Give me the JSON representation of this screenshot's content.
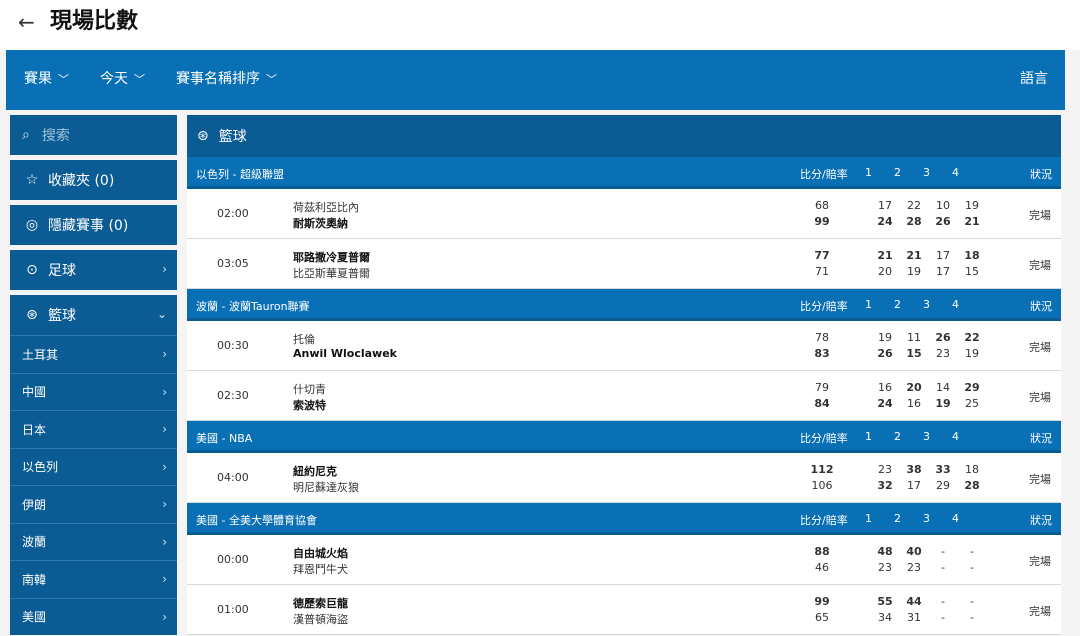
{
  "header": {
    "back_icon": "arrow-left-icon",
    "title": "現場比數"
  },
  "nav": {
    "results": "賽果",
    "today": "今天",
    "sort": "賽事名稱排序",
    "language": "語言"
  },
  "sidebar": {
    "search_placeholder": "搜索",
    "favorites": "收藏夾 (0)",
    "hidden": "隱藏賽事 (0)",
    "football": "足球",
    "basketball": "籃球",
    "countries": [
      "土耳其",
      "中國",
      "日本",
      "以色列",
      "伊朗",
      "波蘭",
      "南韓",
      "美國"
    ]
  },
  "sport": {
    "title": "籃球"
  },
  "columns": {
    "score": "比分/賠率",
    "q1": "1",
    "q2": "2",
    "q3": "3",
    "q4": "4",
    "status": "狀況"
  },
  "leagues": [
    {
      "name": "以色列 - 超級聯盟",
      "matches": [
        {
          "time": "02:00",
          "home": "荷茲利亞比內",
          "away": "耐斯茨奧納",
          "home_score": "68",
          "away_score": "99",
          "home_q": [
            "17",
            "22",
            "10",
            "19"
          ],
          "away_q": [
            "24",
            "28",
            "26",
            "21"
          ],
          "status": "完場"
        },
        {
          "time": "03:05",
          "home": "耶路撒冷夏普爾",
          "away": "比亞斯華夏普爾",
          "home_score": "77",
          "away_score": "71",
          "home_q": [
            "21",
            "21",
            "17",
            "18"
          ],
          "away_q": [
            "20",
            "19",
            "17",
            "15"
          ],
          "status": "完場"
        }
      ]
    },
    {
      "name": "波蘭 - 波蘭Tauron聯賽",
      "matches": [
        {
          "time": "00:30",
          "home": "托倫",
          "away": "Anwil Wloclawek",
          "home_score": "78",
          "away_score": "83",
          "home_q": [
            "19",
            "11",
            "26",
            "22"
          ],
          "away_q": [
            "26",
            "15",
            "23",
            "19"
          ],
          "status": "完場"
        },
        {
          "time": "02:30",
          "home": "什切青",
          "away": "索波特",
          "home_score": "79",
          "away_score": "84",
          "home_q": [
            "16",
            "20",
            "14",
            "29"
          ],
          "away_q": [
            "24",
            "16",
            "19",
            "25"
          ],
          "status": "完場"
        }
      ]
    },
    {
      "name": "美國 - NBA",
      "matches": [
        {
          "time": "04:00",
          "home": "紐約尼克",
          "away": "明尼蘇達灰狼",
          "home_score": "112",
          "away_score": "106",
          "home_q": [
            "23",
            "38",
            "33",
            "18"
          ],
          "away_q": [
            "32",
            "17",
            "29",
            "28"
          ],
          "status": "完場"
        }
      ]
    },
    {
      "name": "美國 - 全美大學體育協會",
      "matches": [
        {
          "time": "00:00",
          "home": "自由城火焰",
          "away": "拜恩鬥牛犬",
          "home_score": "88",
          "away_score": "46",
          "home_q": [
            "48",
            "40",
            "-",
            "-"
          ],
          "away_q": [
            "23",
            "23",
            "-",
            "-"
          ],
          "status": "完場"
        },
        {
          "time": "01:00",
          "home": "德歷索巨龍",
          "away": "漢普頓海盜",
          "home_score": "99",
          "away_score": "65",
          "home_q": [
            "55",
            "44",
            "-",
            "-"
          ],
          "away_q": [
            "34",
            "31",
            "-",
            "-"
          ],
          "status": "完場"
        }
      ]
    }
  ]
}
